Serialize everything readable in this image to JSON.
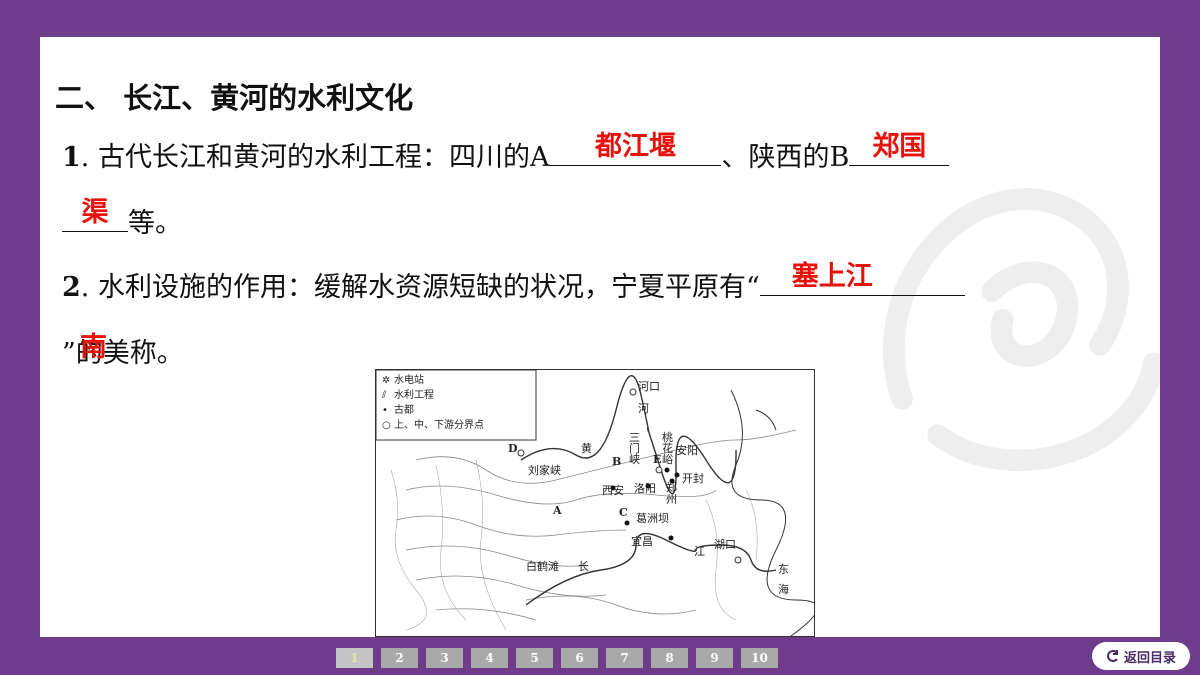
{
  "section_title": "二、 长江、黄河的水利文化",
  "q1": {
    "num": "1",
    "text_a": ". 古代长江和黄河的水利工程：四川的A",
    "answer_a": "都江堰",
    "text_b": "、陕西的B",
    "answer_b_part1": "郑国",
    "answer_b_part2": "渠",
    "text_c": "等。"
  },
  "q2": {
    "num": "2",
    "text_a": ". 水利设施的作用：缓解水资源短缺的状况，宁夏平原有“",
    "answer_part1": "塞上江",
    "answer_part2": "南",
    "text_b": "”的美称。"
  },
  "map": {
    "legend": [
      "水电站",
      "水利工程",
      "古都",
      "上、中、下游分界点"
    ],
    "labels": {
      "hekou": "河口",
      "he": "河",
      "huang": "黄",
      "liujiaxia": "刘家峡",
      "sanmenxia": "三门峡",
      "taohuayu": "桃花峪",
      "anyang": "安阳",
      "kaifeng": "开封",
      "zhengzhou": "郑州",
      "luoyang": "洛阳",
      "xian": "西安",
      "gezhouba": "葛洲坝",
      "yichang": "宜昌",
      "hukou": "湖口",
      "jiang": "江",
      "chang": "长",
      "baihetan": "白鹤滩",
      "donghai": "东海",
      "A": "A",
      "B": "B",
      "C": "C",
      "D": "D",
      "E": "E"
    }
  },
  "pager": [
    "1",
    "2",
    "3",
    "4",
    "5",
    "6",
    "7",
    "8",
    "9",
    "10"
  ],
  "back_label": "返回目录"
}
